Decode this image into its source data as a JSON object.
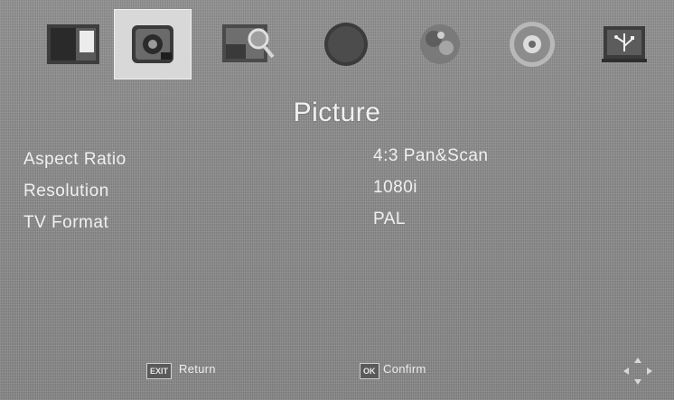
{
  "menu": {
    "tabs": [
      {
        "name": "tv-screen-icon",
        "selected": false
      },
      {
        "name": "picture-settings-icon",
        "selected": true
      },
      {
        "name": "search-picture-icon",
        "selected": false
      },
      {
        "name": "dark-circle-icon",
        "selected": false
      },
      {
        "name": "colorful-swirl-icon",
        "selected": false
      },
      {
        "name": "disc-icon",
        "selected": false
      },
      {
        "name": "usb-icon",
        "selected": false
      }
    ]
  },
  "page": {
    "title": "Picture"
  },
  "settings": [
    {
      "label": "Aspect Ratio",
      "value": "4:3 Pan&Scan"
    },
    {
      "label": "Resolution",
      "value": "1080i"
    },
    {
      "label": "TV Format",
      "value": "PAL"
    }
  ],
  "footer": {
    "return_key": "EXIT",
    "return_label": "Return",
    "confirm_key": "OK",
    "confirm_label": "Confirm"
  }
}
